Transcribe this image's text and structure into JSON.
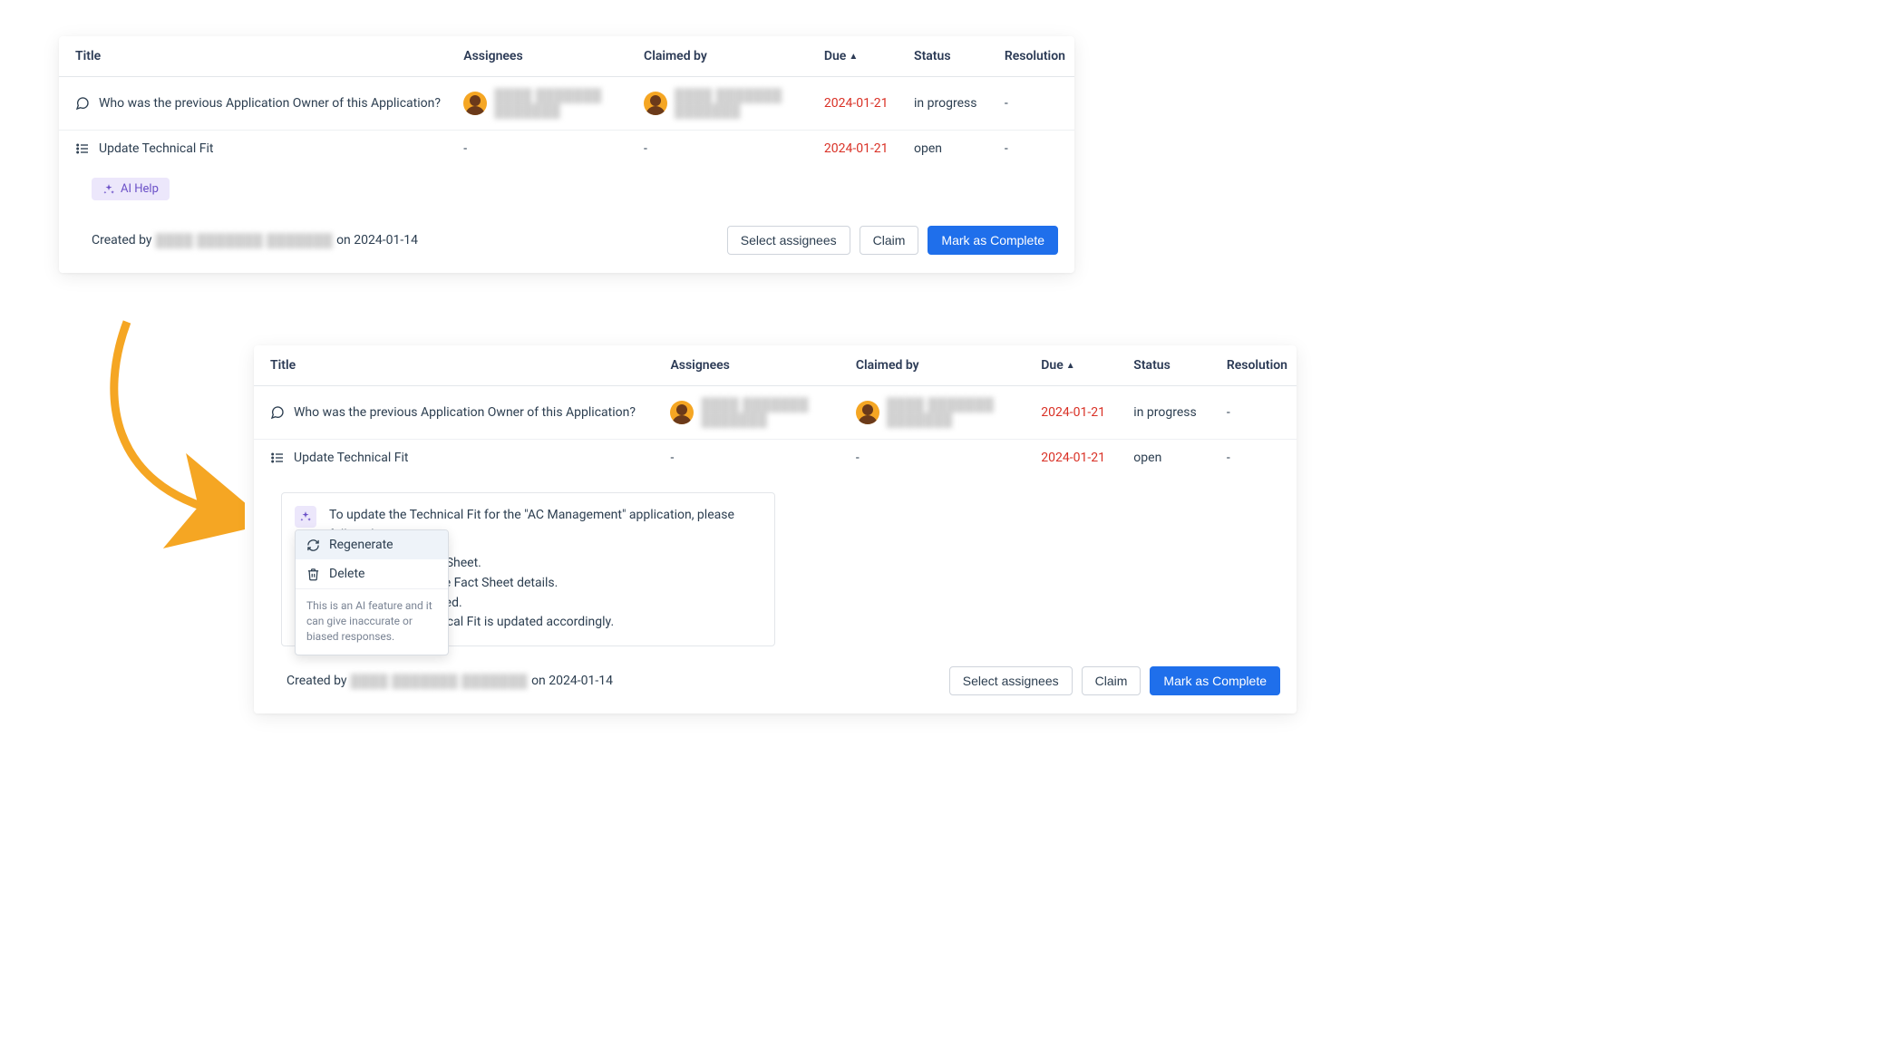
{
  "columns": {
    "title": "Title",
    "assignees": "Assignees",
    "claimed_by": "Claimed by",
    "due": "Due",
    "status": "Status",
    "resolution": "Resolution"
  },
  "rows": [
    {
      "icon": "chat",
      "title": "Who was the previous Application Owner of this Application?",
      "assignee_name": "████ ███████ ███████",
      "claimed_name": "████ ███████ ███████",
      "has_user": true,
      "due": "2024-01-21",
      "status": "in progress",
      "resolution": "-"
    },
    {
      "icon": "list",
      "title": "Update Technical Fit",
      "assignee_name": "-",
      "claimed_name": "-",
      "has_user": false,
      "due": "2024-01-21",
      "status": "open",
      "resolution": "-"
    }
  ],
  "ai_help_chip": "AI Help",
  "footer": {
    "created_by_prefix": "Created by",
    "created_by_name": "████ ███████ ███████",
    "created_on": "on 2024-01-14",
    "select_assignees": "Select assignees",
    "claim": "Claim",
    "mark_complete": "Mark as Complete"
  },
  "ai_response": {
    "intro": "To update the Technical Fit for the \"AC Management\" application, please follow these steps:",
    "step1_prefix": "…",
    "step1": "anagement\" Fact Sheet.",
    "step2": "Fit\" field within the Fact Sheet details.",
    "step3": "Fit\" field as required.",
    "step4": "ensure the Technical Fit is updated accordingly."
  },
  "ai_menu": {
    "regenerate": "Regenerate",
    "delete": "Delete",
    "note": "This is an AI feature and it can give inaccurate or biased responses."
  }
}
